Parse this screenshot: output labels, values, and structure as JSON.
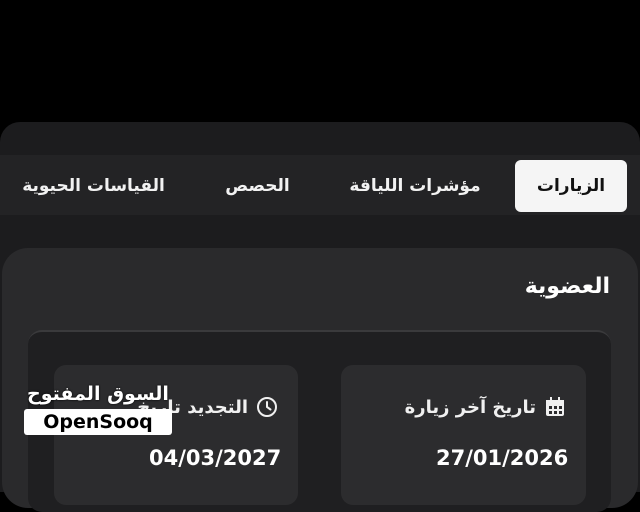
{
  "tabs": [
    {
      "label": "الزيارات",
      "active": true
    },
    {
      "label": "مؤشرات اللياقة",
      "active": false
    },
    {
      "label": "الحصص",
      "active": false
    },
    {
      "label": "القياسات الحيوية",
      "active": false
    }
  ],
  "membership": {
    "title": "العضوية",
    "last_visit": {
      "label": "تاريخ آخر زيارة",
      "value": "27/01/2026",
      "icon": "calendar-icon"
    },
    "renewal": {
      "label": "التجديد تاريخ",
      "value": "04/03/2027",
      "icon": "clock-icon"
    }
  },
  "watermark": {
    "arabic": "السوق المفتوح",
    "latin": "OpenSooq"
  },
  "colors": {
    "background": "#000000",
    "panel": "#1c1c1e",
    "card": "#2a2a2c",
    "active_tab": "#f5f5f5"
  }
}
